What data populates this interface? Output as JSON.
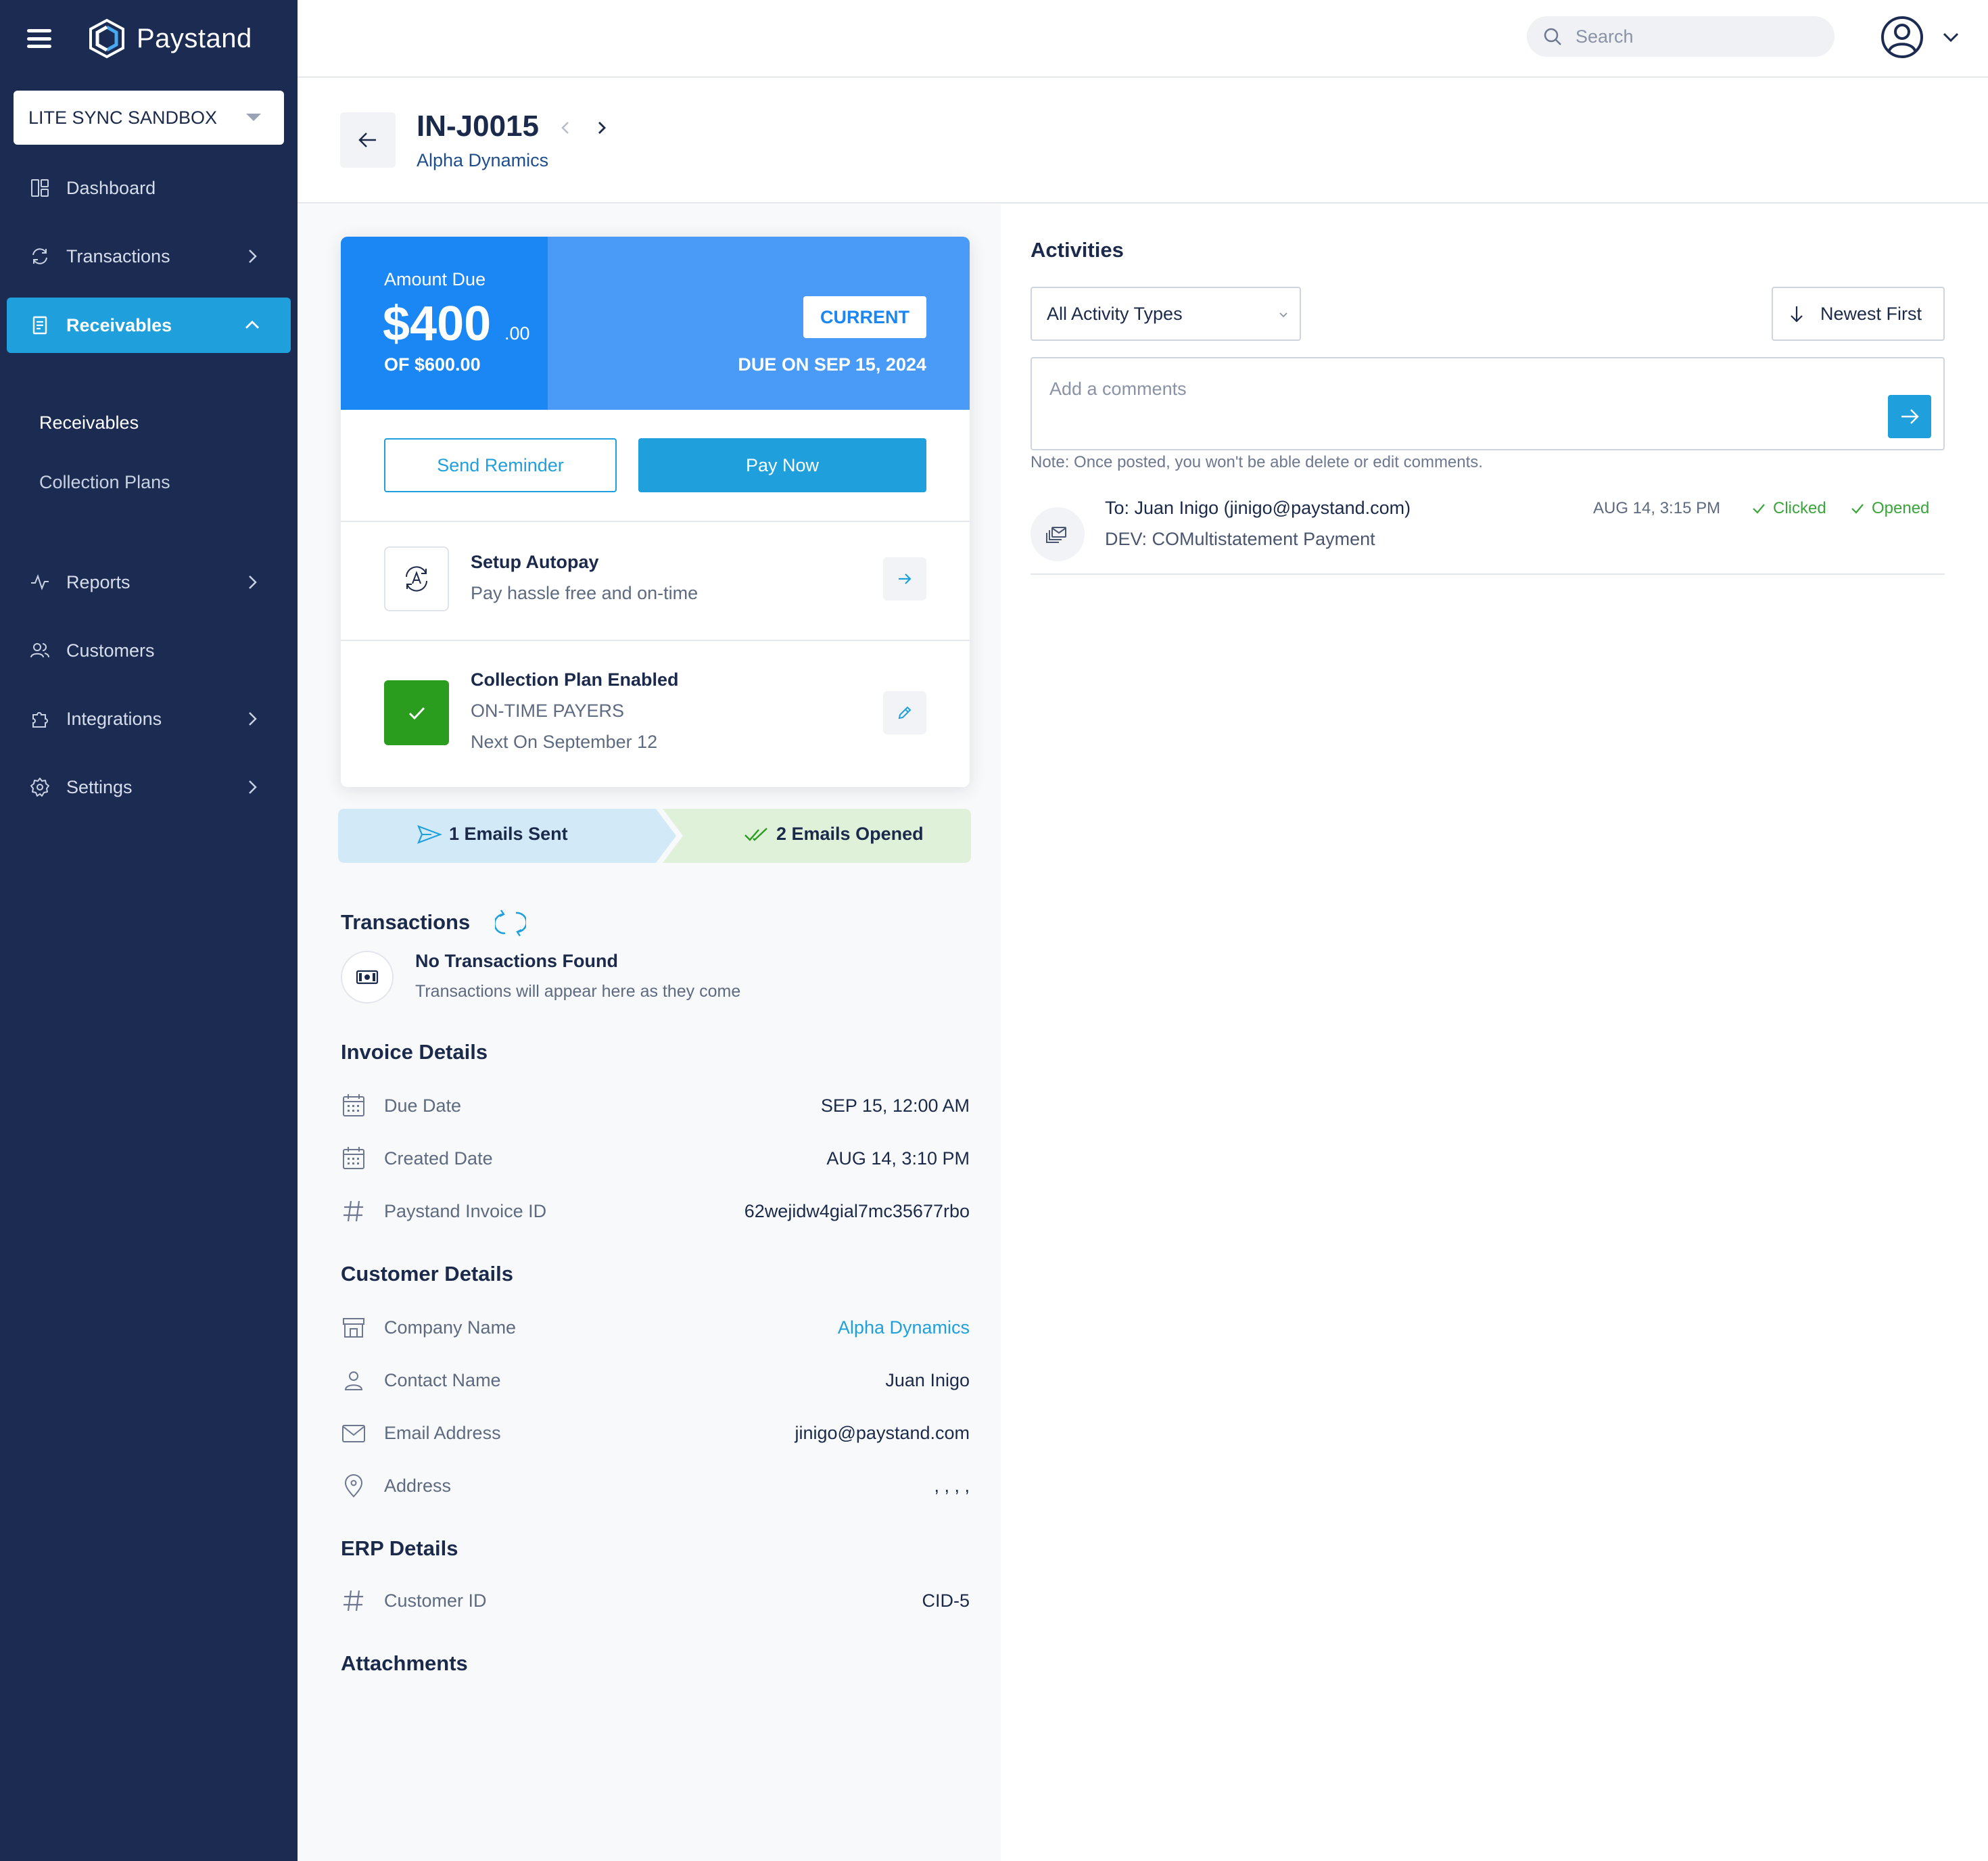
{
  "brand": {
    "name": "Paystand"
  },
  "org_selector": {
    "value": "LITE SYNC SANDBOX"
  },
  "nav": {
    "dashboard": "Dashboard",
    "transactions": "Transactions",
    "receivables": "Receivables",
    "receivables_sub": [
      "Receivables",
      "Collection Plans"
    ],
    "reports": "Reports",
    "customers": "Customers",
    "integrations": "Integrations",
    "settings": "Settings"
  },
  "topbar": {
    "search_placeholder": "Search"
  },
  "invoice": {
    "id": "IN-J0015",
    "company": "Alpha Dynamics"
  },
  "amount": {
    "label": "Amount Due",
    "main": "$400",
    "cents": ".00",
    "of": "OF $600.00",
    "status": "CURRENT",
    "due_on": "DUE ON SEP 15, 2024"
  },
  "actions": {
    "send_reminder": "Send Reminder",
    "pay_now": "Pay Now"
  },
  "autopay": {
    "title": "Setup Autopay",
    "subtitle": "Pay hassle free and on-time"
  },
  "collection_plan": {
    "title": "Collection Plan Enabled",
    "plan": "ON-TIME PAYERS",
    "next": "Next On September 12"
  },
  "emails": {
    "sent": "1 Emails Sent",
    "opened": "2 Emails Opened"
  },
  "transactions": {
    "title": "Transactions",
    "empty_title": "No Transactions Found",
    "empty_sub": "Transactions will appear here as they come"
  },
  "invoice_details": {
    "title": "Invoice Details",
    "rows": [
      {
        "label": "Due Date",
        "value": "SEP 15, 12:00 AM",
        "icon": "calendar-icon"
      },
      {
        "label": "Created Date",
        "value": "AUG 14, 3:10 PM",
        "icon": "calendar-icon"
      },
      {
        "label": "Paystand Invoice ID",
        "value": "62wejidw4gial7mc35677rbo",
        "icon": "hash-icon"
      }
    ]
  },
  "customer_details": {
    "title": "Customer Details",
    "rows": [
      {
        "label": "Company Name",
        "value": "Alpha Dynamics",
        "icon": "store-icon"
      },
      {
        "label": "Contact Name",
        "value": "Juan Inigo",
        "icon": "person-icon"
      },
      {
        "label": "Email Address",
        "value": "jinigo@paystand.com",
        "icon": "mail-icon"
      },
      {
        "label": "Address",
        "value": ", , , ,",
        "icon": "location-pin-icon"
      }
    ]
  },
  "erp_details": {
    "title": "ERP Details",
    "rows": [
      {
        "label": "Customer ID",
        "value": "CID-5",
        "icon": "hash-icon"
      }
    ]
  },
  "attachments": {
    "title": "Attachments"
  },
  "activities": {
    "title": "Activities",
    "filter": "All Activity Types",
    "sort": "Newest First",
    "comment_placeholder": "Add a comments",
    "note": "Note: Once posted, you won't be able delete or edit comments.",
    "items": [
      {
        "to": "To: Juan Inigo (jinigo@paystand.com)",
        "subject": "DEV: COMultistatement Payment",
        "time": "AUG 14, 3:15 PM",
        "tags": [
          "Clicked",
          "Opened"
        ]
      }
    ]
  },
  "colors": {
    "sidebar": "#1b2b52",
    "accent": "#1fa0dc",
    "amount_dark": "#1a87f5",
    "amount_light": "#4a9bf8",
    "success": "#2a9d1f"
  }
}
